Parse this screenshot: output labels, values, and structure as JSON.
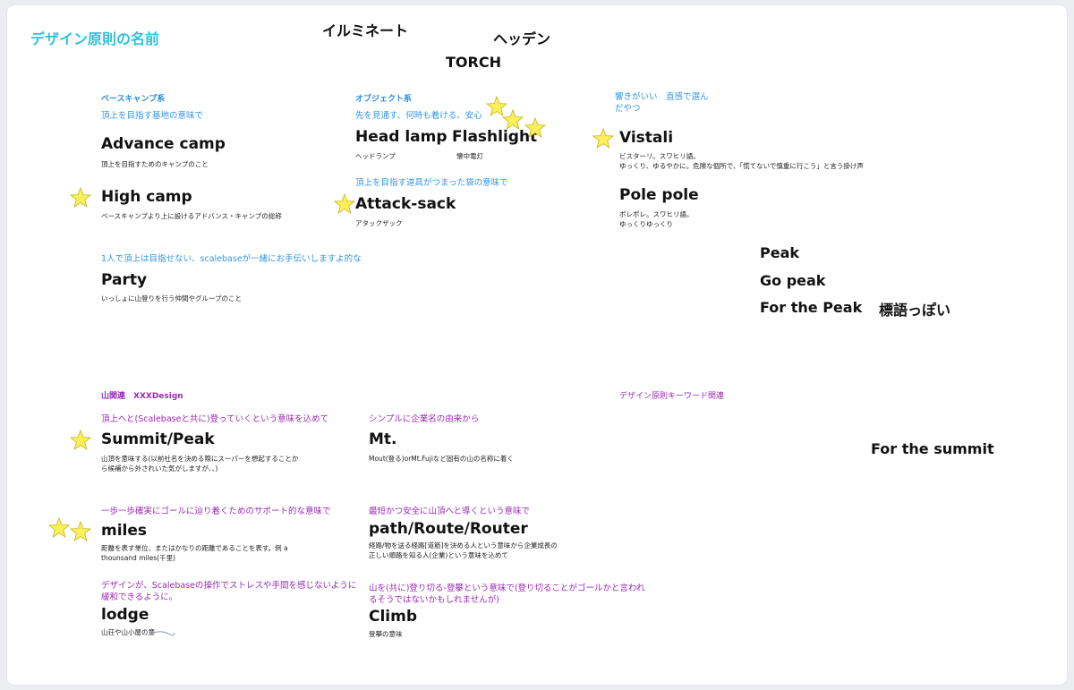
{
  "board": {
    "title": "デザイン原則の名前",
    "floating_words": {
      "illuminate": "イルミネート",
      "hidden": "ヘッデン",
      "torch": "TORCH",
      "peak": "Peak",
      "go_peak": "Go peak",
      "for_the_peak": "For the Peak",
      "slogan_like": "標語っぽい",
      "for_the_summit": "For the summit"
    }
  },
  "basecamp": {
    "section": "ベースキャンプ系",
    "note": "頂上を目指す基地の意味で",
    "advance": {
      "label": "Advance camp",
      "desc": "頂上を目指すためのキャンプのこと"
    },
    "high": {
      "label": "High camp",
      "desc": "ベースキャンプより上に設けるアドバンス・キャンプの総称"
    },
    "party": {
      "note": "1人で頂上は目指せない、scalebaseが一緒にお手伝いしますよ的な",
      "label": "Party",
      "desc": "いっしょに山登りを行う仲間やグループのこと"
    }
  },
  "object": {
    "section": "オブジェクト系",
    "note": "先を見通す、何時も着ける、安心",
    "headlamp": {
      "label": "Head lamp",
      "desc": "ヘッドランプ"
    },
    "flashlight": {
      "label": "Flashlight",
      "desc": "懐中電灯"
    },
    "attack": {
      "note": "頂上を目指す道具がつまった袋の意味で",
      "label": "Attack-sack",
      "desc": "アタックザック"
    }
  },
  "sound": {
    "note_line1": "響きがいい　直感で選ん",
    "note_line2": "だやつ",
    "vistali": {
      "label": "Vistali",
      "desc_line1": "ビスターリ。スワヒリ語。",
      "desc_line2": "ゆっくり、ゆるやかに。危険な個所で、「慌てないで慎重に行こう」と言う掛け声"
    },
    "polepole": {
      "label": "Pole pole",
      "desc_line1": "ポレポレ。スワヒリ語。",
      "desc_line2": "ゆっくりゆっくり"
    }
  },
  "mountain": {
    "section": "山関連　XXXDesign",
    "keyword_section": "デザイン原則キーワード関連",
    "summit": {
      "note": "頂上へと(Scalebaseと共に)登っていくという意味を込めて",
      "label": "Summit/Peak",
      "desc_line1": "山頂を意味する(以前社名を決める際にスーパーを想起することか",
      "desc_line2": "ら候補から外されいた気がしますが、、)"
    },
    "mt": {
      "note": "シンプルに企業名の由来から",
      "label": "Mt.",
      "desc": "Mout(登る)orMt.Fujiなど固有の山の名称に着く"
    },
    "miles": {
      "note": "一歩一歩確実にゴールに辿り着くためのサポート的な意味で",
      "label": "miles",
      "desc_line1": "距離を表す単位、またはかなりの距離であることを表す。例 a",
      "desc_line2": "thounsand miles(千里)"
    },
    "path": {
      "note": "最短かつ安全に山頂へと導くという意味で",
      "label": "path/Route/Router",
      "desc_line1": "経路/物を送る経路[道筋]を決める人という意味から企業成長の",
      "desc_line2": "正しい順路を知る人(企業)という意味を込めて"
    },
    "lodge": {
      "note_line1": "デザインが、Scalebaseの操作でストレスや手間を感じないように",
      "note_line2": "緩和できるように。",
      "label": "lodge",
      "desc": "山荘や山小屋の意"
    },
    "climb": {
      "note_line1": "山を(共に)登り切る-登攀という意味で(登り切ることがゴールかと言われ",
      "note_line2": "るそうではないかもしれませんが)",
      "label": "Climb",
      "desc": "登攀の意味"
    }
  },
  "colors": {
    "title": "#2cc3dc",
    "blue_notes": "#3396e6",
    "purple_notes": "#9b2bb5",
    "star_fill": "#fbf05a",
    "star_stroke": "#c7b21c",
    "canvas": "#ebedf0"
  },
  "icons": {
    "vote_star": "star-icon"
  }
}
